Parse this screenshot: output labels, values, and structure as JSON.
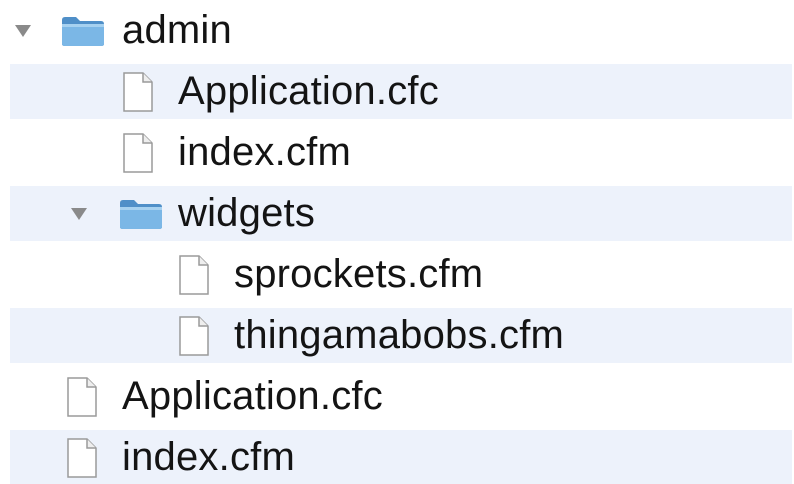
{
  "tree": {
    "items": [
      {
        "label": "admin",
        "type": "folder",
        "expanded": true,
        "icon": "folder-icon"
      },
      {
        "label": "Application.cfc",
        "type": "file",
        "icon": "document-icon"
      },
      {
        "label": "index.cfm",
        "type": "file",
        "icon": "document-icon"
      },
      {
        "label": "widgets",
        "type": "folder",
        "expanded": true,
        "icon": "folder-icon"
      },
      {
        "label": "sprockets.cfm",
        "type": "file",
        "icon": "document-icon"
      },
      {
        "label": "thingamabobs.cfm",
        "type": "file",
        "icon": "document-icon"
      },
      {
        "label": "Application.cfc",
        "type": "file",
        "icon": "document-icon"
      },
      {
        "label": "index.cfm",
        "type": "file",
        "icon": "document-icon"
      }
    ]
  },
  "colors": {
    "stripe": "#edf2fb",
    "folder": "#5aa0d8",
    "text": "#141414",
    "disclosure": "#8a8a8a"
  }
}
